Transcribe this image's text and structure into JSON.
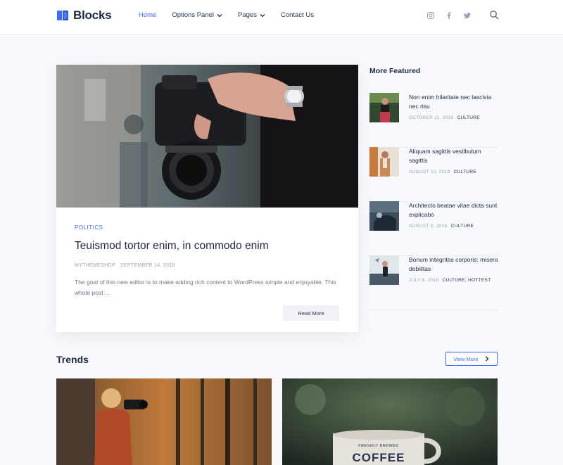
{
  "header": {
    "logo_text": "Blocks",
    "nav": [
      {
        "label": "Home",
        "active": true
      },
      {
        "label": "Options Panel",
        "dropdown": true
      },
      {
        "label": "Pages",
        "dropdown": true
      },
      {
        "label": "Contact Us"
      }
    ],
    "social_icons": [
      "instagram-icon",
      "facebook-icon",
      "twitter-icon"
    ],
    "accent_color": "#3b6cf6"
  },
  "featured": {
    "category": "POLITICS",
    "title": "Teuismod tortor enim, in commodo enim",
    "author": "MYTHEMESHOP",
    "date": "SEPTEMBER 14, 2018",
    "excerpt": "The goal of this new editor is to make adding rich content to WordPress simple and enjoyable. This whole post ...",
    "read_more_label": "Read More"
  },
  "sidebar": {
    "title": "More Featured",
    "items": [
      {
        "title": "Non enim hilaritate nec lascivia nec risu",
        "date": "OCTOBER 11, 2018",
        "category": "CULTURE"
      },
      {
        "title": "Aliquam sagittis vestibulum sagittis",
        "date": "AUGUST 10, 2018",
        "category": "CULTURE"
      },
      {
        "title": "Architecto beatae vitae dicta sunt explicabo",
        "date": "AUGUST 9, 2018",
        "category": "CULTURE"
      },
      {
        "title": "Bonum integritas corporis: misera debilitas",
        "date": "JULY 6, 2018",
        "category": "CULTURE, HOTTEST"
      }
    ]
  },
  "trends": {
    "title": "Trends",
    "view_more_label": "View More",
    "mug_text": "COFFEE",
    "mug_subtext": "FRESHLY BREWED"
  }
}
